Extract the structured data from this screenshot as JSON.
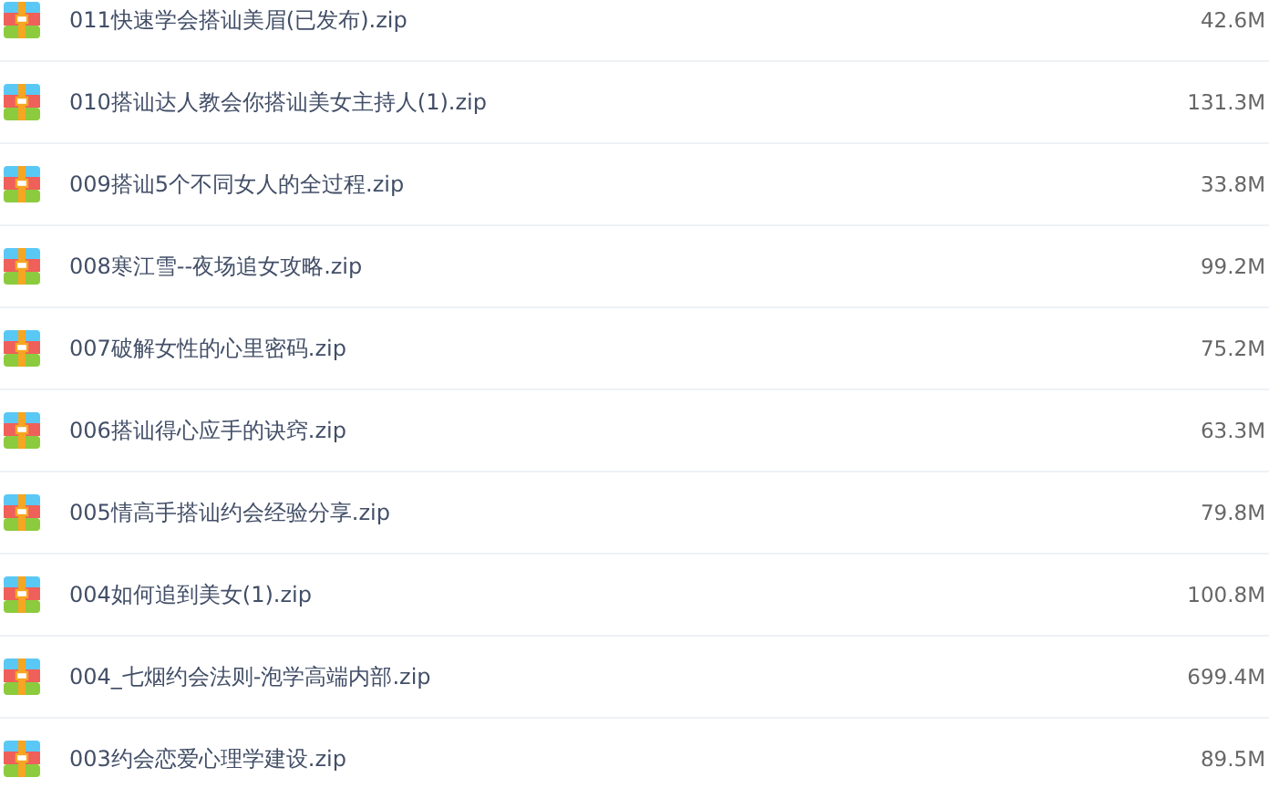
{
  "files": [
    {
      "name": "011快速学会搭讪美眉(已发布).zip",
      "size": "42.6M"
    },
    {
      "name": "010搭讪达人教会你搭讪美女主持人(1).zip",
      "size": "131.3M"
    },
    {
      "name": "009搭讪5个不同女人的全过程.zip",
      "size": "33.8M"
    },
    {
      "name": "008寒江雪--夜场追女攻略.zip",
      "size": "99.2M"
    },
    {
      "name": "007破解女性的心里密码.zip",
      "size": "75.2M"
    },
    {
      "name": "006搭讪得心应手的诀窍.zip",
      "size": "63.3M"
    },
    {
      "name": "005情高手搭讪约会经验分享.zip",
      "size": "79.8M"
    },
    {
      "name": "004如何追到美女(1).zip",
      "size": "100.8M"
    },
    {
      "name": "004_七烟约会法则-泡学高端内部.zip",
      "size": "699.4M"
    },
    {
      "name": "003约会恋爱心理学建设.zip",
      "size": "89.5M"
    }
  ]
}
